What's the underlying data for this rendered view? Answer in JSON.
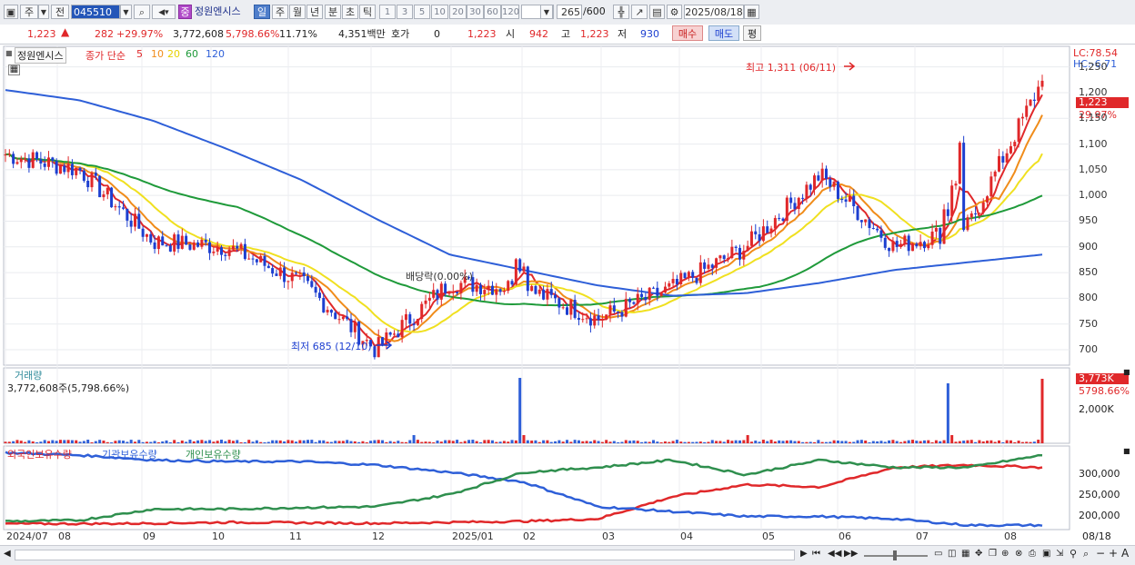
{
  "toolbar": {
    "period_label": "주",
    "prev_label": "전",
    "stock_code": "045510",
    "badge": "중",
    "stock_name": "정원엔시스",
    "periods": [
      "일",
      "주",
      "월",
      "년",
      "분",
      "초",
      "틱"
    ],
    "active_period": "일",
    "intervals": [
      "1",
      "3",
      "5",
      "10",
      "20",
      "30",
      "60",
      "120"
    ],
    "count_value": "265",
    "count_total": "/600",
    "date_value": "2025/08/18"
  },
  "quote": {
    "price": "1,223",
    "change": "282",
    "change_pct": "+29.97%",
    "volume": "3,772,608",
    "volume_ratio": "5,798.66%",
    "turnover": "11.71%",
    "amount": "4,351백만",
    "hoga_label": "호가",
    "hoga_value": "0",
    "hoga_price": "1,223",
    "open_label": "시",
    "open_value": "942",
    "high_label": "고",
    "high_value": "1,223",
    "low_label": "저",
    "low_value": "930",
    "buy_label": "매수",
    "sell_label": "매도",
    "eval_label": "평"
  },
  "price_panel": {
    "title": "정원엔시스",
    "ma_label": "종가 단순",
    "ma_periods": [
      "5",
      "10",
      "20",
      "60",
      "120"
    ],
    "ma_colors": [
      "#e0282a",
      "#f08c1a",
      "#f0e020",
      "#1f9a3a",
      "#2e5fd8"
    ],
    "lc_label": "LC:78.54",
    "hc_label": "HC:-6.71",
    "current_price_tag": "1,223",
    "current_pct_tag": "29.97%",
    "max_annotation": "최고 1,311 (06/11)",
    "min_annotation": "최저 685 (12/10)",
    "dividend_annotation": "배당락(0.00%)",
    "y_ticks": [
      "1,250",
      "1,200",
      "1,150",
      "1,100",
      "1,050",
      "1,000",
      "950",
      "900",
      "850",
      "800",
      "750",
      "700"
    ]
  },
  "volume_panel": {
    "title": "거래량",
    "value_label": "3,772,608주(5,798.66%)",
    "tag_value": "3,773K",
    "tag_pct": "5798.66%",
    "y_tick": "2,000K"
  },
  "holding_panel": {
    "series": [
      "외국인보유수량",
      "기관보유수량",
      "개인보유수량"
    ],
    "series_colors": [
      "#e0282a",
      "#2e5fd8",
      "#2f8f4e"
    ],
    "y_ticks": [
      "300,000",
      "250,000",
      "200,000"
    ]
  },
  "x_axis": {
    "labels": [
      "2024/07",
      "08",
      "09",
      "10",
      "11",
      "12",
      "2025/01",
      "02",
      "03",
      "04",
      "05",
      "06",
      "07",
      "08"
    ],
    "right_label": "08/18"
  },
  "chart_data": {
    "type": "candlestick",
    "title": "정원엔시스",
    "symbol": "045510",
    "period": "일",
    "date_range": [
      "2024/07",
      "2025/08/18"
    ],
    "ylim": [
      670,
      1290
    ],
    "moving_averages": [
      "5",
      "10",
      "20",
      "60",
      "120"
    ],
    "close_series_approx": {
      "x": [
        "2024/07",
        "08",
        "09",
        "10",
        "11",
        "12",
        "2025/01",
        "02",
        "03",
        "04",
        "05",
        "06",
        "07",
        "08",
        "08/18"
      ],
      "close": [
        1080,
        1050,
        910,
        900,
        830,
        700,
        830,
        820,
        760,
        820,
        900,
        1040,
        900,
        940,
        1223
      ]
    },
    "ma120_approx": {
      "x": [
        "2024/07",
        "08",
        "09",
        "10",
        "11",
        "12",
        "2025/01",
        "02",
        "03",
        "04",
        "05",
        "06",
        "07",
        "08",
        "08/18"
      ],
      "values": [
        1205,
        1185,
        1145,
        1090,
        1030,
        955,
        885,
        855,
        825,
        805,
        810,
        830,
        855,
        870,
        885
      ]
    },
    "extremes": {
      "high": 1311,
      "high_date": "06/11",
      "low": 685,
      "low_date": "12/10"
    },
    "last": {
      "close": 1223,
      "open": 942,
      "high": 1223,
      "low": 930,
      "change": 282,
      "change_pct": 29.97
    },
    "volume": {
      "last": 3772608,
      "ratio_pct": 5798.66,
      "tick": "2,000K"
    },
    "holding_ylim": [
      175000,
      340000
    ]
  }
}
